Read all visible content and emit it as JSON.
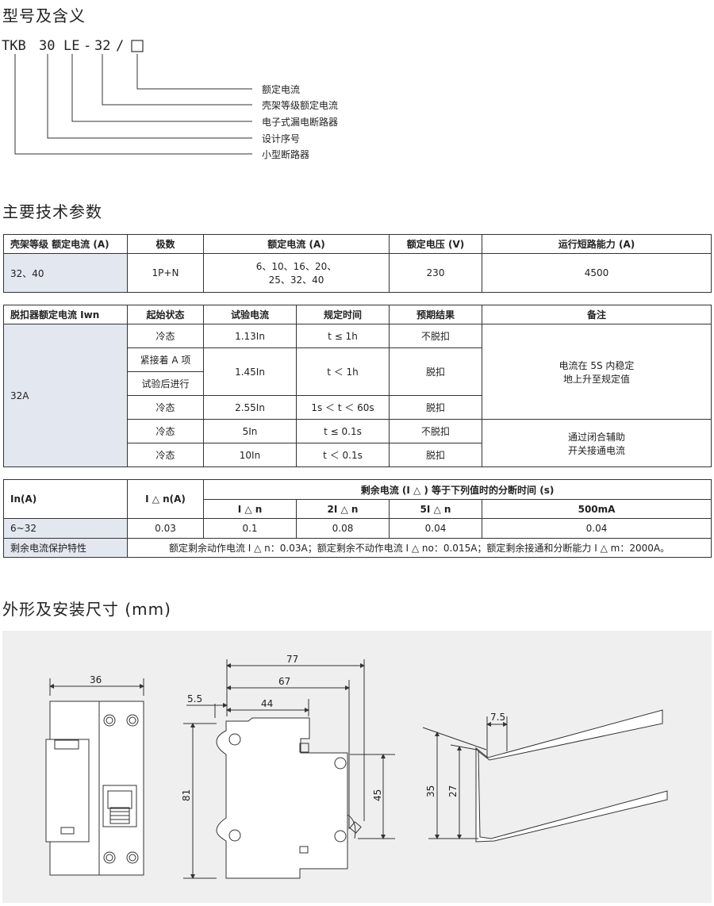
{
  "sections": {
    "model_title": "型号及含义",
    "params_title": "主要技术参数",
    "dims_title": "外形及安装尺寸 (mm)"
  },
  "model": {
    "codes": [
      "TKB",
      "30",
      "LE",
      "-",
      "32",
      "/"
    ],
    "labels": [
      "额定电流",
      "壳架等级额定电流",
      "电子式漏电断路器",
      "设计序号",
      "小型断路器"
    ]
  },
  "table1": {
    "headers": [
      "壳架等级 额定电流 (A)",
      "极数",
      "额定电流 (A)",
      "额定电压 (V)",
      "运行短路能力 (A)"
    ],
    "row": [
      "32、40",
      "1P+N",
      "6、10、16、20、",
      "25、32、40",
      "230",
      "4500"
    ]
  },
  "table2": {
    "headers": [
      "脱扣器额定电流 Iwn",
      "起始状态",
      "试验电流",
      "规定时间",
      "预期结果",
      "备注"
    ],
    "first_col": "32A",
    "rows": [
      [
        "冷态",
        "1.13In",
        "t ≤ 1h",
        "不脱扣"
      ],
      [
        "紧接着 A 项",
        "1.45In",
        "t ＜ 1h",
        "脱扣"
      ],
      [
        "试验后进行"
      ],
      [
        "冷态",
        "2.55In",
        "1s ＜ t ＜ 60s",
        "脱扣"
      ],
      [
        "冷态",
        "5In",
        "t ≤ 0.1s",
        "不脱扣"
      ],
      [
        "冷态",
        "10In",
        "t ＜ 0.1s",
        "脱扣"
      ]
    ],
    "note1": [
      "电流在 5S 内稳定",
      "地上升至规定值"
    ],
    "note2": [
      "通过闭合辅助",
      "开关接通电流"
    ]
  },
  "table3": {
    "h_in": "In(A)",
    "h_idn": "I △ n(A)",
    "h_group": "剩余电流 (I △ ) 等于下列值时的分断时间 (s)",
    "sub": [
      "I △ n",
      "2I △ n",
      "5I △ n",
      "500mA"
    ],
    "row": [
      "6~32",
      "0.03",
      "0.1",
      "0.08",
      "0.04",
      "0.04"
    ],
    "prot_label": "剩余电流保护特性",
    "prot_text": "额定剩余动作电流 I △ n：0.03A；额定剩余不动作电流 I △ no：0.015A；额定剩余接通和分断能力 I △ m：2000A。"
  },
  "dims": {
    "front_width": "36",
    "d77": "77",
    "d67": "67",
    "d55": "5.5",
    "d44": "44",
    "d81": "81",
    "d45": "45",
    "d75": "7.5",
    "d35": "35",
    "d27": "27"
  }
}
